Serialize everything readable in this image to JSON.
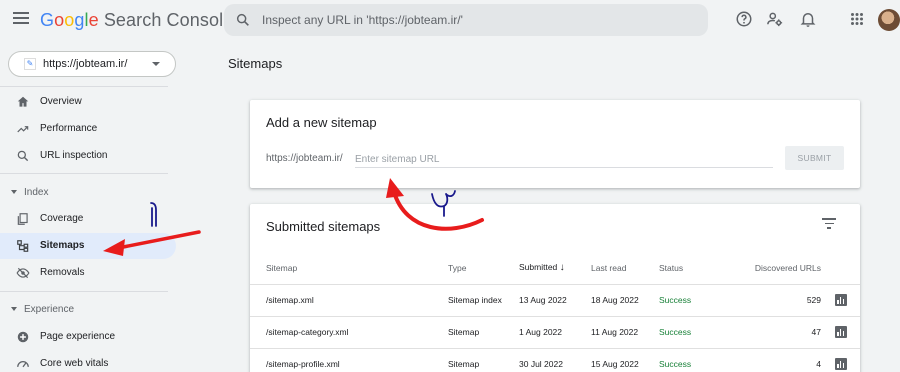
{
  "header": {
    "logo_google": [
      "G",
      "o",
      "o",
      "g",
      "l",
      "e"
    ],
    "logo_product": "Search Console",
    "search_placeholder": "Inspect any URL in 'https://jobteam.ir/'",
    "icons": [
      "help-icon",
      "manage-users-icon",
      "bell-icon",
      "apps-grid-icon"
    ]
  },
  "sidebar": {
    "property": "https://jobteam.ir/",
    "items": [
      {
        "label": "Overview",
        "icon": "home-icon"
      },
      {
        "label": "Performance",
        "icon": "trending-up-icon"
      },
      {
        "label": "URL inspection",
        "icon": "search-icon"
      }
    ],
    "index_section": "Index",
    "index_items": [
      {
        "label": "Coverage",
        "icon": "coverage-icon"
      },
      {
        "label": "Sitemaps",
        "icon": "sitemap-icon",
        "active": true
      },
      {
        "label": "Removals",
        "icon": "removals-icon"
      }
    ],
    "experience_section": "Experience",
    "experience_items": [
      {
        "label": "Page experience",
        "icon": "page-experience-icon"
      },
      {
        "label": "Core web vitals",
        "icon": "speed-icon"
      }
    ]
  },
  "main": {
    "title": "Sitemaps",
    "add_card": {
      "title": "Add a new sitemap",
      "prefix": "https://jobteam.ir/",
      "placeholder": "Enter sitemap URL",
      "submit_label": "SUBMIT"
    },
    "submitted_card": {
      "title": "Submitted sitemaps",
      "columns": [
        "Sitemap",
        "Type",
        "Submitted",
        "Last read",
        "Status",
        "Discovered URLs"
      ],
      "rows": [
        {
          "sitemap": "/sitemap.xml",
          "type": "Sitemap index",
          "submitted": "13 Aug 2022",
          "last_read": "18 Aug 2022",
          "status": "Success",
          "discovered": "529"
        },
        {
          "sitemap": "/sitemap-category.xml",
          "type": "Sitemap",
          "submitted": "1 Aug 2022",
          "last_read": "11 Aug 2022",
          "status": "Success",
          "discovered": "47"
        },
        {
          "sitemap": "/sitemap-profile.xml",
          "type": "Sitemap",
          "submitted": "30 Jul 2022",
          "last_read": "15 Aug 2022",
          "status": "Success",
          "discovered": "4"
        }
      ]
    }
  },
  "colors": {
    "accent": "#1a73e8",
    "active_bg": "#e1ebfb",
    "success": "#188038",
    "annotation_red": "#e81c1c",
    "annotation_blue": "#1a1a8c"
  }
}
